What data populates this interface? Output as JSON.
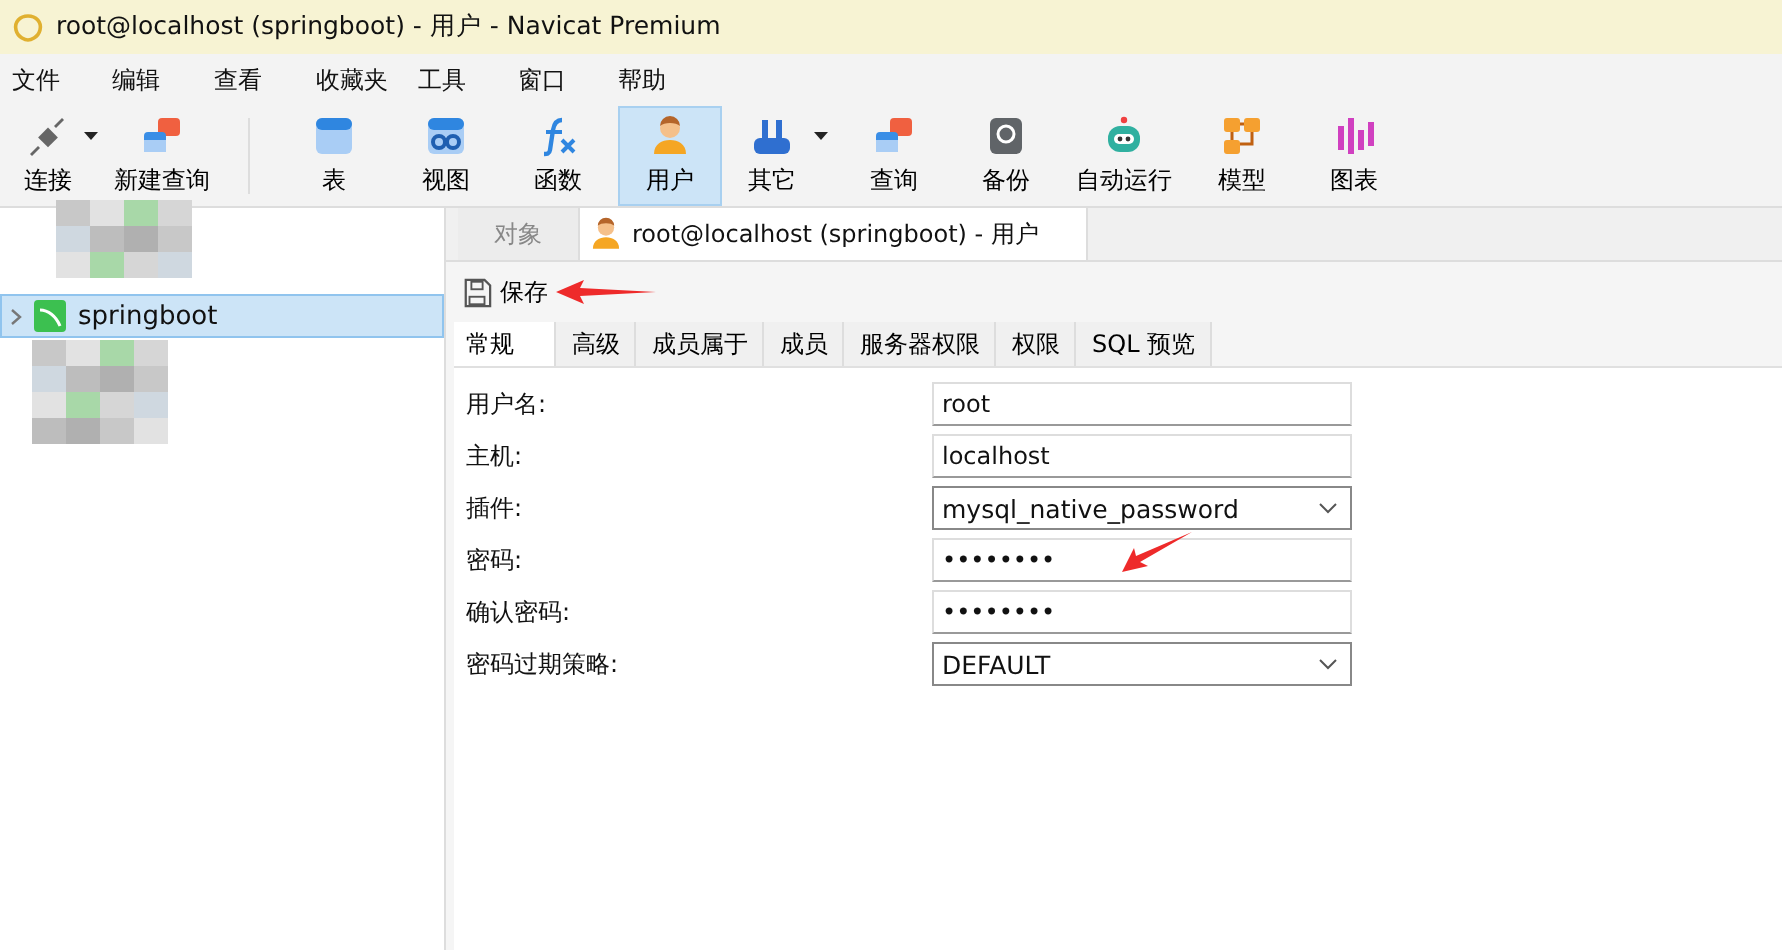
{
  "window": {
    "title": "root@localhost (springboot) - 用户 - Navicat Premium"
  },
  "menu": [
    "文件",
    "编辑",
    "查看",
    "收藏夹",
    "工具",
    "窗口",
    "帮助"
  ],
  "toolbar": [
    {
      "label": "连接",
      "kind": "plug",
      "dropdown": true,
      "selected": false
    },
    {
      "label": "新建查询",
      "kind": "query",
      "dropdown": false,
      "selected": false
    },
    {
      "label": "表",
      "kind": "table",
      "dropdown": false,
      "selected": false
    },
    {
      "label": "视图",
      "kind": "view",
      "dropdown": false,
      "selected": false
    },
    {
      "label": "函数",
      "kind": "function",
      "dropdown": false,
      "selected": false
    },
    {
      "label": "用户",
      "kind": "user",
      "dropdown": false,
      "selected": true
    },
    {
      "label": "其它",
      "kind": "other",
      "dropdown": true,
      "selected": false
    },
    {
      "label": "查询",
      "kind": "query",
      "dropdown": false,
      "selected": false
    },
    {
      "label": "备份",
      "kind": "backup",
      "dropdown": false,
      "selected": false
    },
    {
      "label": "自动运行",
      "kind": "robot",
      "dropdown": false,
      "selected": false
    },
    {
      "label": "模型",
      "kind": "model",
      "dropdown": false,
      "selected": false
    },
    {
      "label": "图表",
      "kind": "chart",
      "dropdown": false,
      "selected": false
    }
  ],
  "sidebar": {
    "items": [
      {
        "label": "springboot",
        "selected": true
      }
    ]
  },
  "doc_tabs": [
    {
      "label": "对象",
      "selected": false,
      "icon": false
    },
    {
      "label": "root@localhost (springboot) - 用户",
      "selected": true,
      "icon": true
    }
  ],
  "save_button": {
    "label": "保存"
  },
  "sub_tabs": [
    {
      "label": "常规",
      "selected": true
    },
    {
      "label": "高级",
      "selected": false
    },
    {
      "label": "成员属于",
      "selected": false
    },
    {
      "label": "成员",
      "selected": false
    },
    {
      "label": "服务器权限",
      "selected": false
    },
    {
      "label": "权限",
      "selected": false
    },
    {
      "label": "SQL 预览",
      "selected": false
    }
  ],
  "form": [
    {
      "label": "用户名:",
      "value": "root",
      "kind": "text"
    },
    {
      "label": "主机:",
      "value": "localhost",
      "kind": "text"
    },
    {
      "label": "插件:",
      "value": "mysql_native_password",
      "kind": "select"
    },
    {
      "label": "密码:",
      "value": "••••••••",
      "kind": "text"
    },
    {
      "label": "确认密码:",
      "value": "••••••••",
      "kind": "text"
    },
    {
      "label": "密码过期策略:",
      "value": "DEFAULT",
      "kind": "select"
    }
  ]
}
